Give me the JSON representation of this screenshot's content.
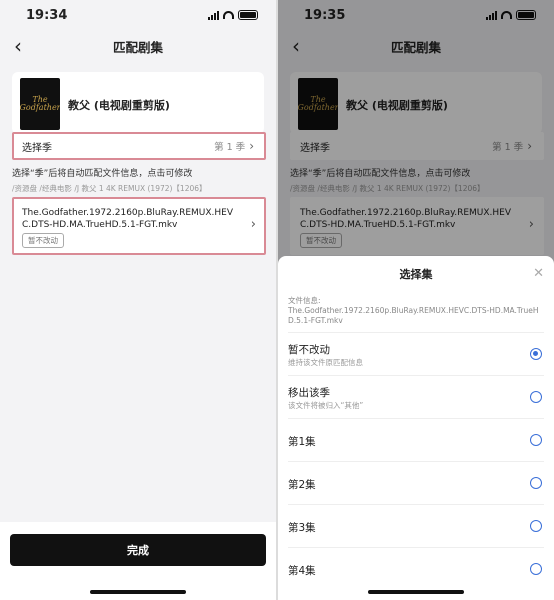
{
  "left": {
    "time": "19:34",
    "nav_title": "匹配剧集",
    "movie_title": "教父 (电视剧重剪版)",
    "poster_text_1": "The",
    "poster_text_2": "Godfather",
    "season_label": "选择季",
    "season_value": "第 1 季",
    "hint": "选择“季”后将自动匹配文件信息，点击可修改",
    "path": "/资源盘 /经典电影 /J 教父 1 4K REMUX (1972)【1206】",
    "file_name": "The.Godfather.1972.2160p.BluRay.REMUX.HEVC.DTS-HD.MA.TrueHD.5.1-FGT.mkv",
    "file_tag": "暂不改动",
    "done_label": "完成"
  },
  "right": {
    "time": "19:35",
    "nav_title": "匹配剧集",
    "movie_title": "教父 (电视剧重剪版)",
    "poster_text_1": "The",
    "poster_text_2": "Godfather",
    "season_label": "选择季",
    "season_value": "第 1 季",
    "hint": "选择“季”后将自动匹配文件信息，点击可修改",
    "path": "/资源盘 /经典电影 /J 教父 1 4K REMUX (1972)【1206】",
    "file_name": "The.Godfather.1972.2160p.BluRay.REMUX.HEVC.DTS-HD.MA.TrueHD.5.1-FGT.mkv",
    "file_tag": "暂不改动",
    "sheet": {
      "title": "选择集",
      "file_info_label": "文件信息:",
      "file_info": "The.Godfather.1972.2160p.BluRay.REMUX.HEVC.DTS-HD.MA.TrueHD.5.1-FGT.mkv",
      "options": [
        {
          "label": "暂不改动",
          "desc": "维持该文件原匹配信息",
          "checked": true
        },
        {
          "label": "移出该季",
          "desc": "该文件将被归入“其他”",
          "checked": false
        },
        {
          "label": "第1集",
          "desc": "",
          "checked": false
        },
        {
          "label": "第2集",
          "desc": "",
          "checked": false
        },
        {
          "label": "第3集",
          "desc": "",
          "checked": false
        },
        {
          "label": "第4集",
          "desc": "",
          "checked": false
        }
      ]
    }
  },
  "colors": {
    "highlight_border": "#d98a95",
    "radio_accent": "#3a6fd8",
    "done_button": "#111111"
  }
}
